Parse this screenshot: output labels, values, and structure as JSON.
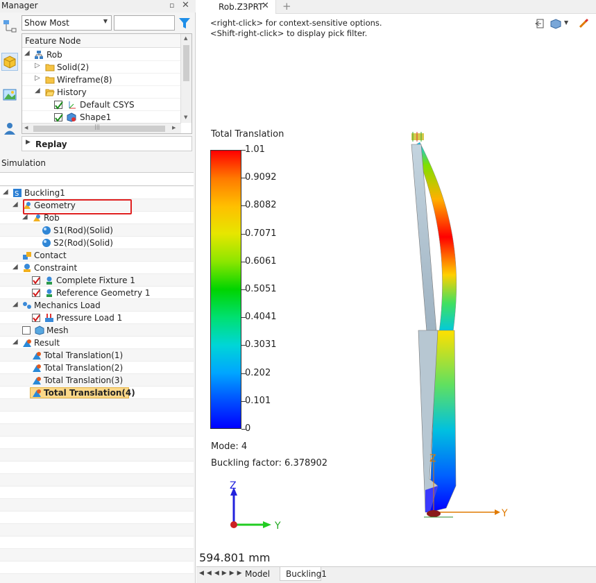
{
  "manager": {
    "title": "Manager",
    "filter_value": "Show Most",
    "feature_header": "Feature Node",
    "feature_tree": [
      "Rob",
      "Solid(2)",
      "Wireframe(8)",
      "History",
      "Default CSYS",
      "Shape1"
    ],
    "scroll_grip": "|||",
    "replay_label": "Replay"
  },
  "simulation": {
    "title": "Simulation",
    "tree": [
      {
        "label": "Buckling1"
      },
      {
        "label": "Geometry"
      },
      {
        "label": "Rob"
      },
      {
        "label": "S1(Rod)(Solid)"
      },
      {
        "label": "S2(Rod)(Solid)"
      },
      {
        "label": "Contact"
      },
      {
        "label": "Constraint"
      },
      {
        "label": "Complete Fixture 1",
        "checked": true
      },
      {
        "label": "Reference Geometry 1",
        "checked": true
      },
      {
        "label": "Mechanics Load"
      },
      {
        "label": "Pressure Load 1",
        "checked": true
      },
      {
        "label": "Mesh",
        "checked": false
      },
      {
        "label": "Result"
      },
      {
        "label": "Total Translation(1)"
      },
      {
        "label": "Total Translation(2)"
      },
      {
        "label": "Total Translation(3)"
      },
      {
        "label": "Total Translation(4)",
        "selected": true
      }
    ]
  },
  "document": {
    "tab_label": "Rob.Z3PRT",
    "hint_line1": "<right-click> for context-sensitive options.",
    "hint_line2": "<Shift-right-click> to display pick filter."
  },
  "legend": {
    "title": "Total Translation",
    "labels": [
      "1.01",
      "0.9092",
      "0.8082",
      "0.7071",
      "0.6061",
      "0.5051",
      "0.4041",
      "0.3031",
      "0.202",
      "0.101",
      "0"
    ],
    "colors": [
      "#ff0000",
      "#ff7a00",
      "#ffbf00",
      "#e6e600",
      "#8ce600",
      "#00d400",
      "#00e070",
      "#00d6d6",
      "#00a6ff",
      "#0050ff",
      "#0000ff"
    ]
  },
  "results": {
    "mode": "Mode: 4",
    "buckling_factor": "Buckling factor: 6.378902",
    "scale": "594.801 mm"
  },
  "axes": {
    "z": "Z",
    "y": "Y"
  },
  "bottom_tabs": [
    "Model",
    "Buckling1"
  ]
}
